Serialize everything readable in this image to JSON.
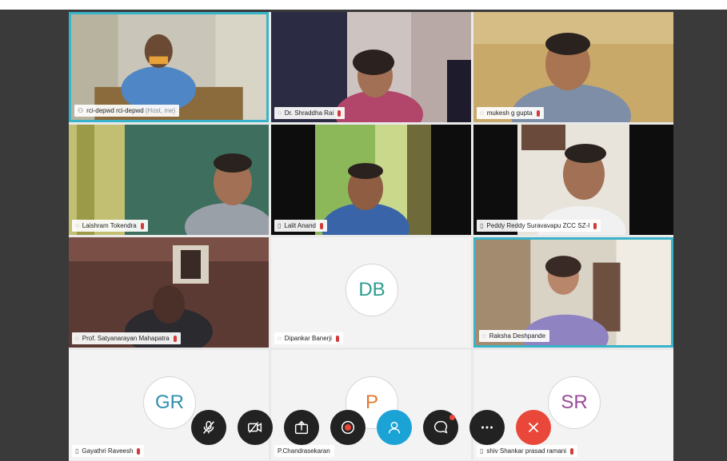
{
  "participants": [
    {
      "name": "rci-depwd rci-depwd",
      "tag": "(Host, me)",
      "icon": "speaker-icon",
      "muted": false,
      "initials": "",
      "initials_color": ""
    },
    {
      "name": "Dr. Shraddha Rai",
      "tag": "",
      "icon": "speaker-icon",
      "muted": true,
      "initials": "",
      "initials_color": ""
    },
    {
      "name": "mukesh g gupta",
      "tag": "",
      "icon": "speaker-icon",
      "muted": true,
      "initials": "",
      "initials_color": ""
    },
    {
      "name": "Laishram Tokendra",
      "tag": "",
      "icon": "speaker-icon",
      "muted": true,
      "initials": "",
      "initials_color": ""
    },
    {
      "name": "Lalit Anand",
      "tag": "",
      "icon": "phone-icon",
      "muted": true,
      "initials": "",
      "initials_color": ""
    },
    {
      "name": "Peddy Reddy Suravavapu ZCC SZ-I",
      "tag": "",
      "icon": "phone-icon",
      "muted": true,
      "initials": "",
      "initials_color": ""
    },
    {
      "name": "Prof. Satyanarayan Mahapatra",
      "tag": "",
      "icon": "speaker-icon",
      "muted": true,
      "initials": "",
      "initials_color": ""
    },
    {
      "name": "Dipankar Banerji",
      "tag": "",
      "icon": "speaker-icon",
      "muted": true,
      "initials": "DB",
      "initials_color": "#2e9c8f"
    },
    {
      "name": "Raksha Deshpande",
      "tag": "",
      "icon": "speaker-icon",
      "muted": false,
      "initials": "",
      "initials_color": ""
    },
    {
      "name": "Gayathri Raveesh",
      "tag": "",
      "icon": "phone-icon",
      "muted": true,
      "initials": "GR",
      "initials_color": "#2f8fb0"
    },
    {
      "name": "P.Chandrasekaran",
      "tag": "",
      "icon": "phone-icon",
      "muted": false,
      "initials": "P",
      "initials_color": "#e07a2e"
    },
    {
      "name": "shiv Shankar prasad ramani",
      "tag": "",
      "icon": "phone-icon",
      "muted": true,
      "initials": "SR",
      "initials_color": "#9a4a9a"
    }
  ],
  "toolbar": [
    {
      "name": "mute-button",
      "icon": "muted-microphone-icon"
    },
    {
      "name": "video-button",
      "icon": "video-off-icon"
    },
    {
      "name": "share-button",
      "icon": "share-icon"
    },
    {
      "name": "record-button",
      "icon": "record-icon"
    },
    {
      "name": "participants-button",
      "icon": "participants-icon"
    },
    {
      "name": "chat-button",
      "icon": "chat-icon"
    },
    {
      "name": "more-button",
      "icon": "more-icon"
    },
    {
      "name": "leave-button",
      "icon": "close-icon"
    }
  ],
  "colors": {
    "active_border": "#39b3c9",
    "toolbar_bg": "#222222",
    "participants_active": "#1ba3d6",
    "leave": "#e8473a"
  }
}
